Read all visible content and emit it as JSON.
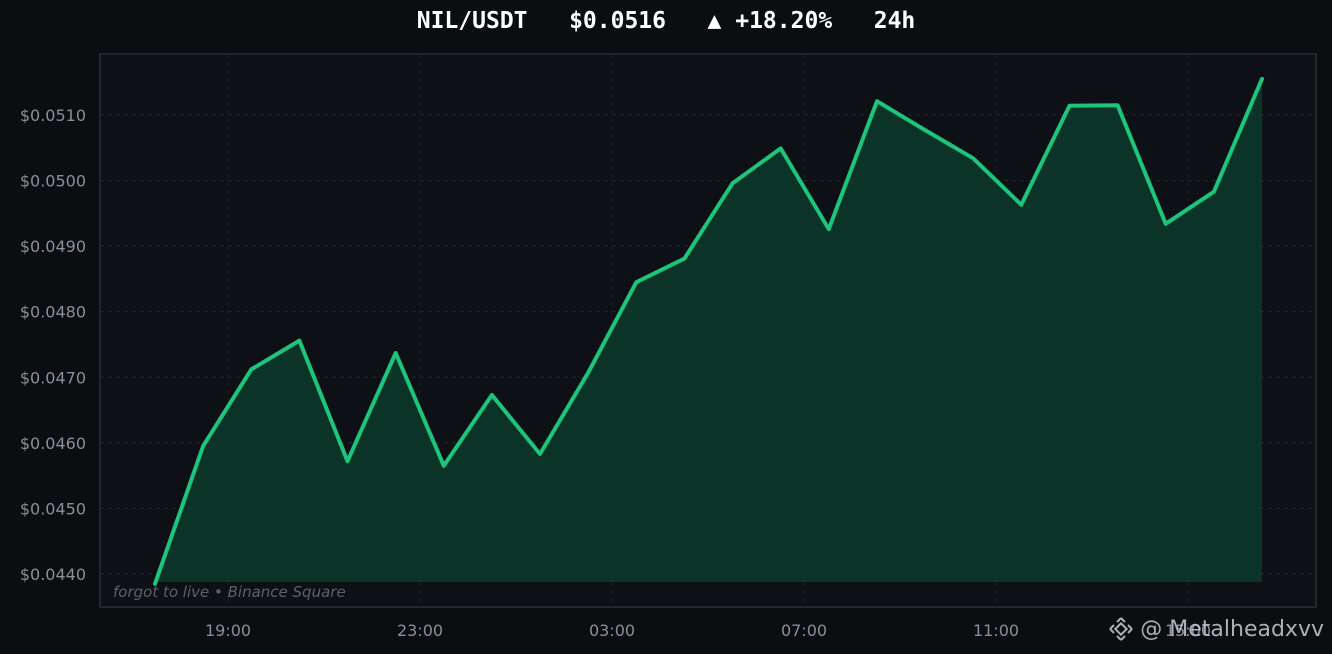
{
  "header": {
    "pair": "NIL/USDT",
    "price": "$0.0516",
    "change": "▲ +18.20%",
    "period": "24h"
  },
  "caption": "forgot to live  •  Binance Square",
  "watermark": {
    "handle": "@ Metalheadxvv",
    "icon": "binance-logo-icon"
  },
  "colors": {
    "line": "#1dc47c",
    "fill": "#0b3f2d",
    "background": "#0b0e11",
    "grid": "#252a31"
  },
  "chart_data": {
    "type": "area",
    "ylim": [
      0.04385,
      0.052
    ],
    "yticks": [
      0.044,
      0.045,
      0.046,
      0.047,
      0.048,
      0.049,
      0.05,
      0.051
    ],
    "ytick_labels": [
      "$0.0440",
      "$0.0450",
      "$0.0460",
      "$0.0470",
      "$0.0480",
      "$0.0490",
      "$0.0500",
      "$0.0510"
    ],
    "xlim": [
      16.5,
      40.0
    ],
    "xticks": [
      19,
      23,
      27,
      31,
      35,
      39
    ],
    "xtick_labels": [
      "19:00",
      "23:00",
      "03:00",
      "07:00",
      "11:00",
      "15:00"
    ],
    "grid": true,
    "series": [
      {
        "x": [
          17.62,
          18.62,
          19.62,
          20.62,
          21.62,
          22.62,
          23.62,
          24.62,
          25.62,
          26.62,
          27.62,
          28.62,
          29.62,
          30.62,
          31.62,
          32.62,
          33.62,
          34.62,
          35.62,
          36.62,
          37.62,
          38.62,
          39.62,
          40.62
        ],
        "values": [
          0.04385,
          0.04595,
          0.04712,
          0.04756,
          0.04572,
          0.04737,
          0.04565,
          0.04673,
          0.04583,
          0.04707,
          0.04845,
          0.04881,
          0.04996,
          0.05049,
          0.04926,
          0.05121,
          0.05077,
          0.05034,
          0.04963,
          0.05114,
          0.05115,
          0.04934,
          0.04983,
          0.05155
        ]
      }
    ]
  }
}
